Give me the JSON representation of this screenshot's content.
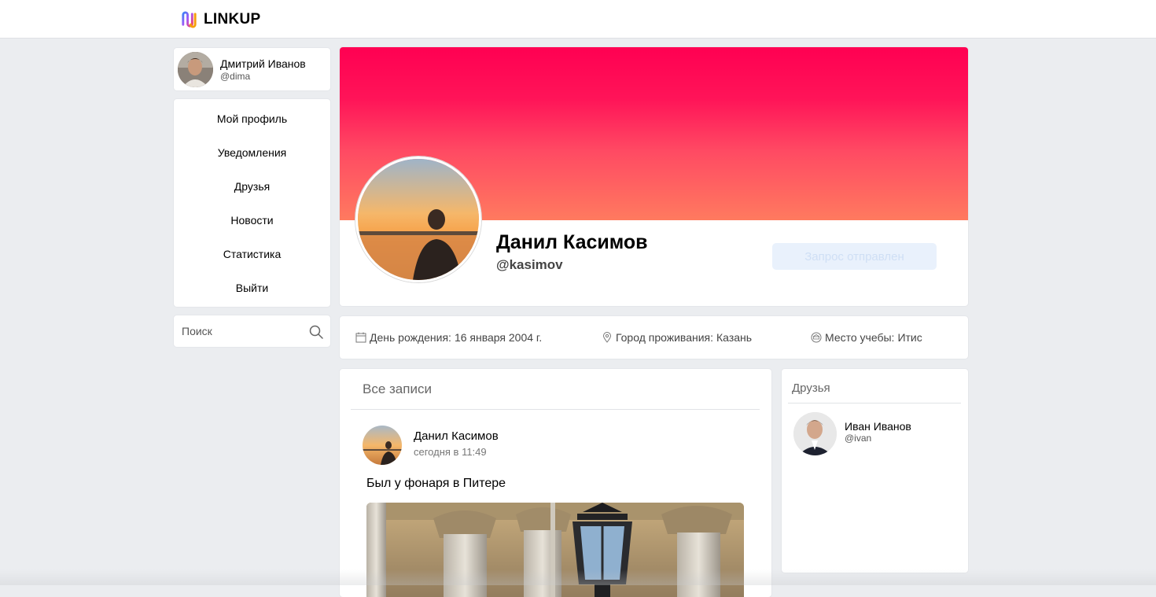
{
  "app": {
    "logo_text": "LINKUP",
    "accent_color": "#ff0052"
  },
  "current_user": {
    "name": "Дмитрий Иванов",
    "handle": "@dima"
  },
  "menu": {
    "items": [
      {
        "label": "Мой профиль"
      },
      {
        "label": "Уведомления"
      },
      {
        "label": "Друзья"
      },
      {
        "label": "Новости"
      },
      {
        "label": "Статистика"
      },
      {
        "label": "Выйти"
      }
    ]
  },
  "search": {
    "placeholder": "Поиск",
    "icon": "search-icon"
  },
  "profile": {
    "name": "Данил Касимов",
    "handle": "@kasimov",
    "request_button_label": "Запрос отправлен",
    "cover_colors": [
      "#ff0052",
      "#ff7a5f"
    ]
  },
  "info": {
    "birthday": {
      "label": "День рождения:",
      "value": "16 января 2004 г.",
      "icon": "calendar-icon"
    },
    "city": {
      "label": "Город проживания:",
      "value": "Казань",
      "icon": "location-pin-icon"
    },
    "study": {
      "label": "Место учебы:",
      "value": "Итис",
      "icon": "school-icon"
    }
  },
  "posts": {
    "title": "Все записи",
    "items": [
      {
        "author": "Данил Касимов",
        "time": "сегодня в 11:49",
        "text": "Был у фонаря в Питере"
      }
    ]
  },
  "friends": {
    "title": "Друзья",
    "items": [
      {
        "name": "Иван Иванов",
        "handle": "@ivan"
      }
    ]
  }
}
